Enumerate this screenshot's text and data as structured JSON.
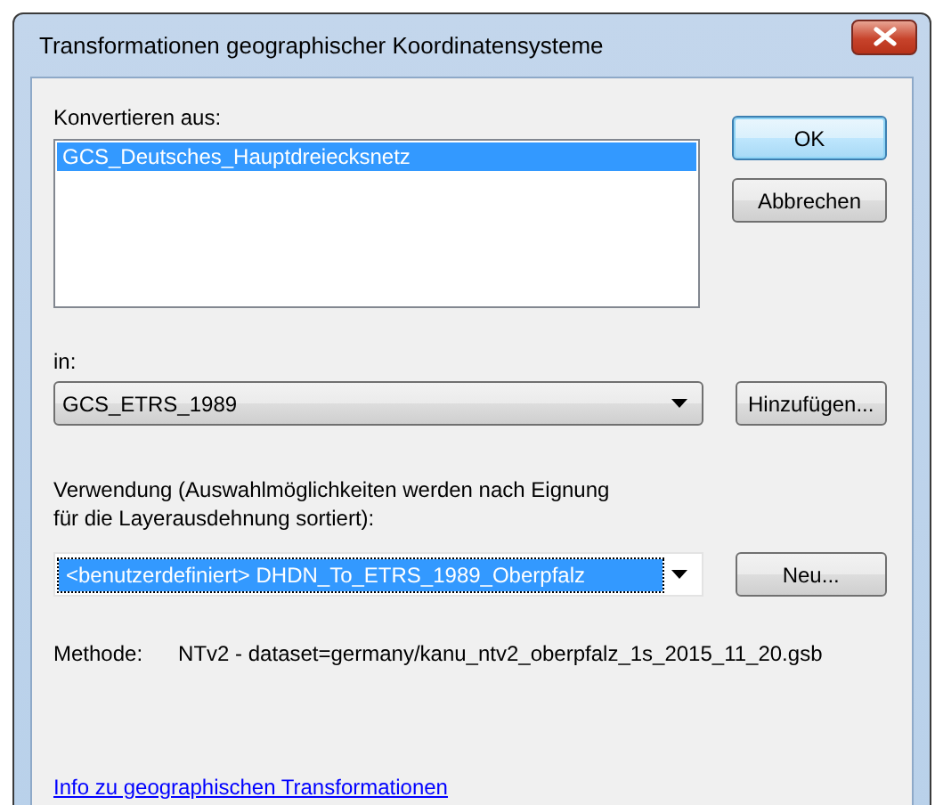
{
  "window": {
    "title": "Transformationen geographischer Koordinatensysteme"
  },
  "source": {
    "label": "Konvertieren aus:",
    "items": [
      {
        "text": "GCS_Deutsches_Hauptdreiecksnetz",
        "selected": true
      }
    ]
  },
  "buttons": [
    "OK",
    "Abbrechen"
  ],
  "target": {
    "label": "in:",
    "value": "GCS_ETRS_1989",
    "button": "Hinzufügen..."
  },
  "usage": {
    "label": "Verwendung (Auswahlmöglichkeiten werden nach Eignung\nfür die Layerausdehnung sortiert):",
    "value": "<benutzerdefiniert> DHDN_To_ETRS_1989_Oberpfalz",
    "selected": true,
    "button": "Neu..."
  },
  "method": {
    "label": "Methode:",
    "value": "NTv2 - dataset=germany/kanu_ntv2_oberpfalz_1s_2015_11_20.gsb"
  },
  "link": "Info zu geographischen Transformationen"
}
